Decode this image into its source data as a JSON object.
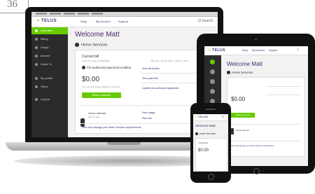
{
  "fragment": {
    "text": "36"
  },
  "laptop": {
    "brand": "TELUS",
    "nav": [
      "Shop",
      "My Account",
      "Support"
    ],
    "search": "Q Search",
    "sidebar": [
      "Overview",
      "Billing",
      "Usage",
      "Internet",
      "Guide Tv",
      "My profile",
      "Offers",
      "Log out"
    ],
    "welcome": "Welcome Matt",
    "section": "Home Services",
    "card": {
      "title": "Current bill",
      "account": "Account number 1234567890",
      "bill_period": "Bill cycle: Mar 02, 2017 – Mar 31, 2017",
      "preauth": "Pre-authorized payments enabled",
      "amount": "$0.00",
      "note": "Your next bill will be charged on Apr 2017",
      "pay_button": "Make a payment",
      "links": [
        "View bill details",
        "View past bills",
        "Update pre-authorized payments"
      ],
      "service": "Home Internet",
      "service_sub": "Internet plan",
      "service_links": [
        "View usage",
        "Plan info"
      ],
      "footer": "View and manage your Home Services appointments"
    }
  },
  "tablet": {
    "brand": "TELUS",
    "nav": [
      "Shop",
      "My Account",
      "Support"
    ],
    "welcome": "Welcome Matt",
    "section": "Home Services",
    "amount": "$0.00",
    "pay_button": "Make a payment",
    "service": "Home Internet",
    "footer": "View and manage your Home Services appointments"
  },
  "phone": {
    "brand": "TELUS",
    "welcome": "Welcome Matt",
    "section": "Home Services",
    "bill_label": "Current bill",
    "amount": "$0.00"
  }
}
